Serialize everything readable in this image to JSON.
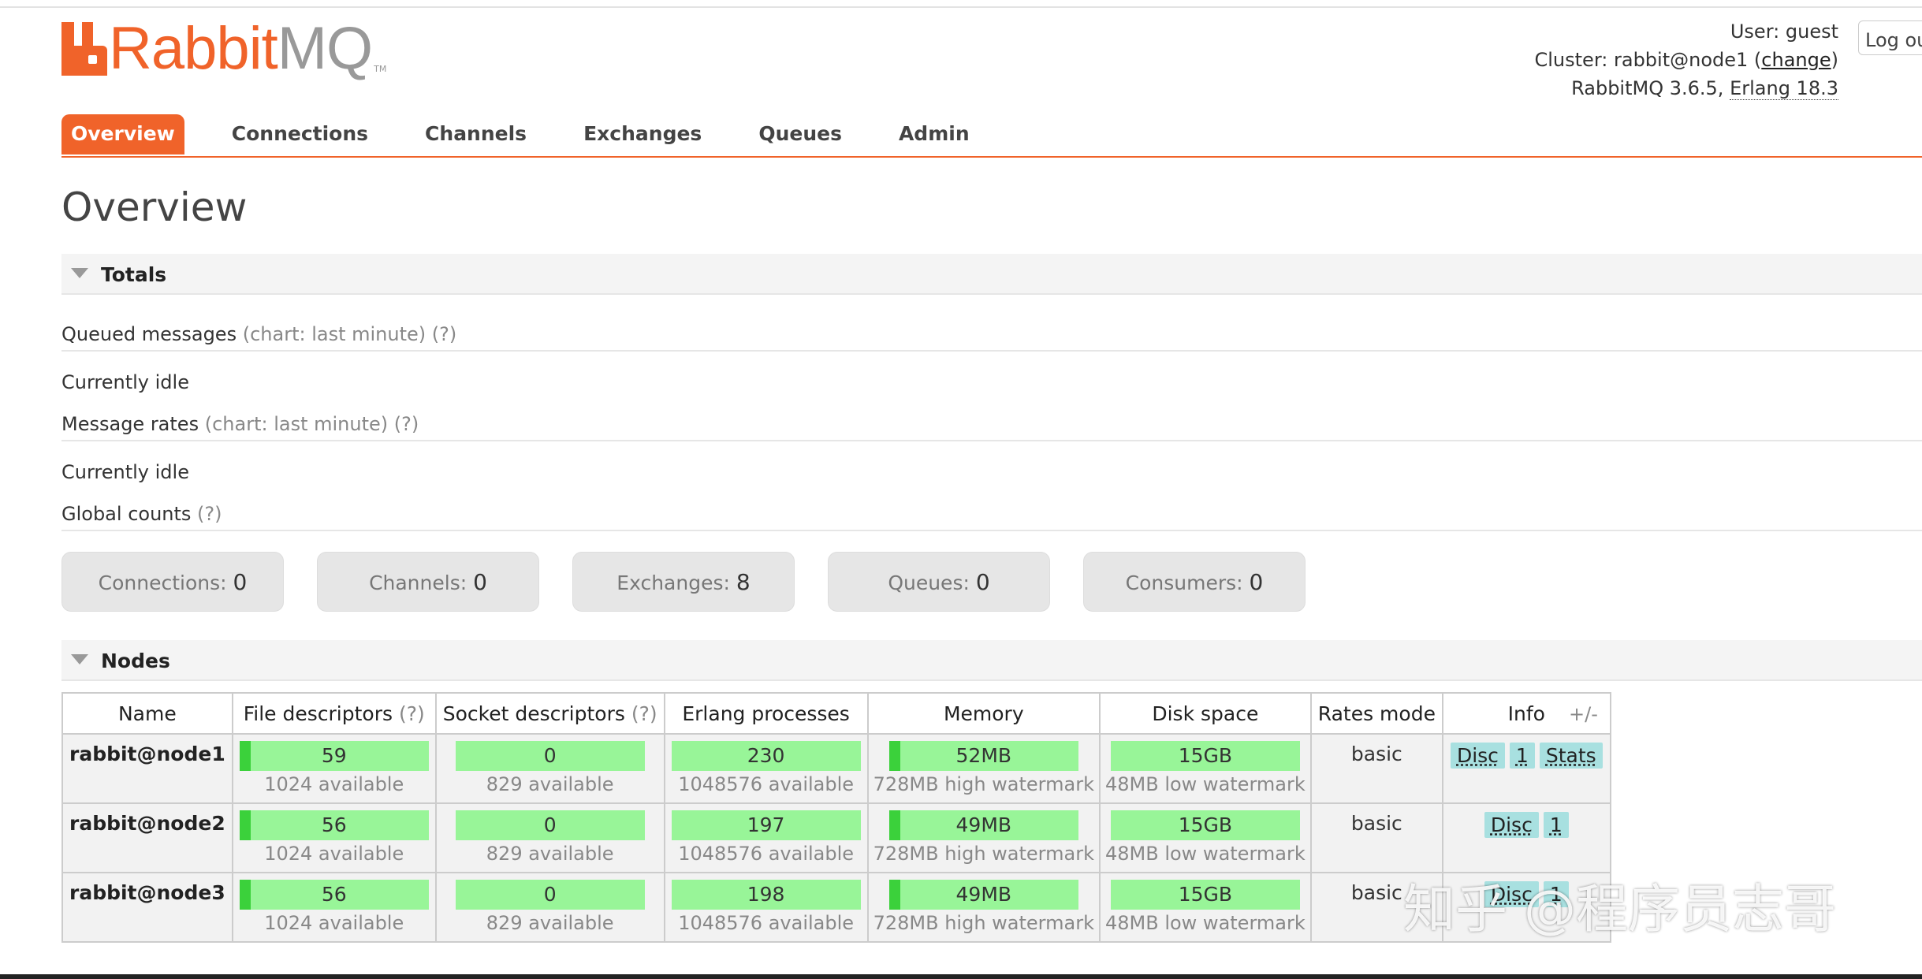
{
  "logo": {
    "rabbit": "Rabbit",
    "mq": "MQ",
    "tm": "TM"
  },
  "header": {
    "user_label": "User:",
    "user": "guest",
    "cluster_label": "Cluster:",
    "cluster": "rabbit@node1",
    "change": "change",
    "version": "RabbitMQ 3.6.5,",
    "erlang": "Erlang 18.3",
    "logout": "Log out"
  },
  "tabs": [
    {
      "label": "Overview",
      "active": true
    },
    {
      "label": "Connections"
    },
    {
      "label": "Channels"
    },
    {
      "label": "Exchanges"
    },
    {
      "label": "Queues"
    },
    {
      "label": "Admin"
    }
  ],
  "page_title": "Overview",
  "totals": {
    "title": "Totals",
    "queued_label": "Queued messages",
    "queued_chart": "(chart: last minute)",
    "help": "(?)",
    "idle1": "Currently idle",
    "rates_label": "Message rates",
    "rates_chart": "(chart: last minute)",
    "idle2": "Currently idle",
    "global_label": "Global counts",
    "counts": [
      {
        "label": "Connections:",
        "value": "0"
      },
      {
        "label": "Channels:",
        "value": "0"
      },
      {
        "label": "Exchanges:",
        "value": "8"
      },
      {
        "label": "Queues:",
        "value": "0"
      },
      {
        "label": "Consumers:",
        "value": "0"
      }
    ]
  },
  "nodes": {
    "title": "Nodes",
    "plus_minus": "+/-",
    "columns": [
      "Name",
      "File descriptors",
      "Socket descriptors",
      "Erlang processes",
      "Memory",
      "Disk space",
      "Rates mode",
      "Info"
    ],
    "help": "(?)",
    "rows": [
      {
        "name": "rabbit@node1",
        "fd": "59",
        "fd_sub": "1024 available",
        "sd": "0",
        "sd_sub": "829 available",
        "ep": "230",
        "ep_sub": "1048576 available",
        "mem": "52MB",
        "mem_sub": "728MB high watermark",
        "disk": "15GB",
        "disk_sub": "48MB low watermark",
        "rates": "basic",
        "badges": [
          "Disc",
          "1",
          "Stats"
        ]
      },
      {
        "name": "rabbit@node2",
        "fd": "56",
        "fd_sub": "1024 available",
        "sd": "0",
        "sd_sub": "829 available",
        "ep": "197",
        "ep_sub": "1048576 available",
        "mem": "49MB",
        "mem_sub": "728MB high watermark",
        "disk": "15GB",
        "disk_sub": "48MB low watermark",
        "rates": "basic",
        "badges": [
          "Disc",
          "1"
        ]
      },
      {
        "name": "rabbit@node3",
        "fd": "56",
        "fd_sub": "1024 available",
        "sd": "0",
        "sd_sub": "829 available",
        "ep": "198",
        "ep_sub": "1048576 available",
        "mem": "49MB",
        "mem_sub": "728MB high watermark",
        "disk": "15GB",
        "disk_sub": "48MB low watermark",
        "rates": "basic",
        "badges": [
          "Disc",
          "1"
        ]
      }
    ]
  },
  "watermark": "知乎 @程序员志哥"
}
